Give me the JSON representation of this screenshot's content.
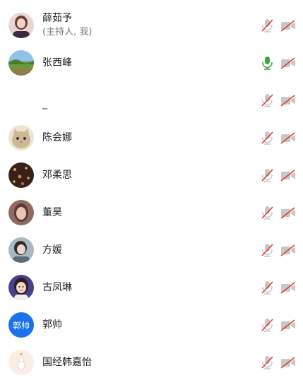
{
  "participants": [
    {
      "name": "薛茹予",
      "role": "(主持人, 我)",
      "avatar": "photo-avatar-girl",
      "mic": "muted",
      "camera": "off"
    },
    {
      "name": "张西峰",
      "avatar": "photo-avatar-landscape",
      "mic": "active",
      "camera": "off"
    },
    {
      "name": "_",
      "avatar": "blank-avatar",
      "mic": "muted",
      "camera": "off"
    },
    {
      "name": "陈会娜",
      "avatar": "photo-avatar-cat",
      "mic": "muted",
      "camera": "off"
    },
    {
      "name": "邓柔思",
      "avatar": "photo-avatar-dark",
      "mic": "muted",
      "camera": "off"
    },
    {
      "name": "董昊",
      "avatar": "photo-avatar-girl-face",
      "mic": "muted",
      "camera": "off"
    },
    {
      "name": "方媛",
      "avatar": "photo-avatar-girl-2",
      "mic": "muted",
      "camera": "off"
    },
    {
      "name": "古凤琳",
      "avatar": "illustrated-avatar",
      "mic": "muted",
      "camera": "off"
    },
    {
      "name": "郭帅",
      "avatar_text": "郭帅",
      "avatar": "text-avatar",
      "avatar_color": "#1a73e8",
      "mic": "muted",
      "camera": "off"
    },
    {
      "name": "国经韩嘉怡",
      "avatar": "photo-avatar-light",
      "mic": "muted",
      "camera": "off"
    }
  ],
  "colors": {
    "muted_icon": "#c8c8c8",
    "muted_slash": "#e53935",
    "mic_active": "#43a047",
    "camera_off": "#c8c8c8"
  }
}
